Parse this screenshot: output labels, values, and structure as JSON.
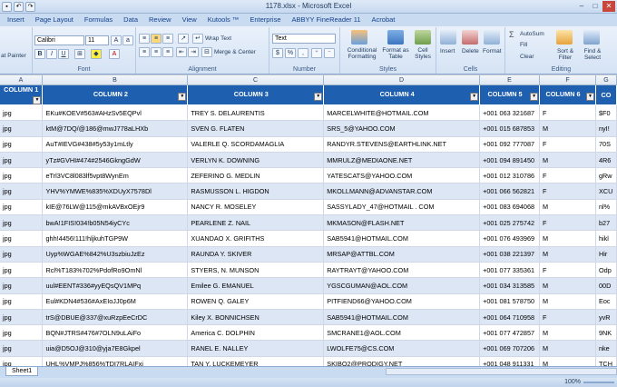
{
  "window": {
    "title": "1178.xlsx - Microsoft Excel"
  },
  "tabs": [
    "Insert",
    "Page Layout",
    "Formulas",
    "Data",
    "Review",
    "View",
    "Kutools ™",
    "Enterprise",
    "ABBYY FineReader 11",
    "Acrobat"
  ],
  "ribbon": {
    "clipboard": {
      "format_painter": "at Painter"
    },
    "font": {
      "name": "Calibri",
      "size": "11",
      "label": "Font"
    },
    "alignment": {
      "wrap_text": "Wrap Text",
      "merge_center": "Merge & Center",
      "label": "Alignment"
    },
    "number": {
      "format": "Text",
      "label": "Number"
    },
    "styles": {
      "conditional": "Conditional Formatting",
      "format_table": "Format as Table",
      "cell_styles": "Cell Styles",
      "label": "Styles"
    },
    "cells": {
      "insert": "Insert",
      "delete": "Delete",
      "format": "Format",
      "label": "Cells"
    },
    "editing": {
      "autosum": "AutoSum",
      "fill": "Fill",
      "clear": "Clear",
      "sort_filter": "Sort & Filter",
      "find_select": "Find & Select",
      "label": "Editing"
    }
  },
  "column_letters": [
    "A",
    "B",
    "C",
    "D",
    "E",
    "F",
    "G"
  ],
  "headers": [
    "COLUMN 1",
    "COLUMN 2",
    "COLUMN 3",
    "COLUMN 4",
    "COLUMN 5",
    "COLUMN 6",
    "CO"
  ],
  "rows": [
    [
      "jpg",
      "EKu#KOEV#563#AHzSv5EQPvl",
      "TREY S. DELAURENTIS",
      "MARCELWHITE@HOTMAIL.COM",
      "+001 063 321687",
      "F",
      "$F0"
    ],
    [
      "jpg",
      "ktM@7DQ/@186@mwJ778aLHXb",
      "SVEN G. FLATEN",
      "SRS_5@YAHOO.COM",
      "+001 015 687853",
      "M",
      "nyI!"
    ],
    [
      "jpg",
      "AuT#IEVG#438#5y53y1mLtly",
      "VALERLE Q. SCORDAMAGLIA",
      "RANDYR.STEVENS@EARTHLINK.NET",
      "+001 092 777087",
      "F",
      "70S"
    ],
    [
      "jpg",
      "yTz#GVHI#474#2546GkngGdW",
      "VERLYN K. DOWNING",
      "MMRULZ@MEDIAONE.NET",
      "+001 094 891450",
      "M",
      "4R6"
    ],
    [
      "jpg",
      "eTrl3VC8l083lf5vpt8WynEm",
      "ZEFERINO G. MEDLIN",
      "YATESCATS@YAHOO.COM",
      "+001 012 310786",
      "F",
      "gRw"
    ],
    [
      "jpg",
      "YHV%YMWE%835%XDUyX7578Dl",
      "RASMUSSON L. HIGDON",
      "MKOLLMANN@ADVANSTAR.COM",
      "+001 066 562821",
      "F",
      "XCU"
    ],
    [
      "jpg",
      "kIE@76LW@115@mkAVBxOEjr9",
      "NANCY R. MOSELEY",
      "SASSYLADY_47@HOTMAIL . COM",
      "+001 083 694068",
      "M",
      "nl%"
    ],
    [
      "jpg",
      "bwA!1FIS!034!b05N54iyCYc",
      "PEARLENE Z. NAIL",
      "MKMASON@FLASH.NET",
      "+001 025 275742",
      "F",
      "b27"
    ],
    [
      "jpg",
      "ghh!4456!111!hljkuhTGP9W",
      "XUANDAO X. GRIFITHS",
      "SAB5941@HOTMAIL.COM",
      "+001 076 493969",
      "M",
      "hikl"
    ],
    [
      "jpg",
      "Uyp%WGAE%842%U3szbiuJzEz",
      "RAUNDA Y. SKIVER",
      "MRSAP@ATTBL.COM",
      "+001 038 221397",
      "M",
      "Hir"
    ],
    [
      "jpg",
      "Rcl%T183%702%PdofRo9OmNl",
      "STYERS, N. MUNSON",
      "RAYTRAYT@YAHOO.COM",
      "+001 077 335361",
      "F",
      "Odp"
    ],
    [
      "jpg",
      "uul#EENT#336#yyEQsQV1MPq",
      "Emilee G. EMANUEL",
      "YGSCGUMAN@AOL.COM",
      "+001 034 313585",
      "M",
      "00D"
    ],
    [
      "jpg",
      "Eul#KDN4#536#AxEIoJJ0p6M",
      "ROWEN Q. GALEY",
      "PITFIEND66@YAHOO.COM",
      "+001 081 578750",
      "M",
      "Eoc"
    ],
    [
      "jpg",
      "trS@DBUE@337@xuRzpEeCrDC",
      "Kiley X. BONNICHSEN",
      "SAB5941@HOTMAIL.COM",
      "+001 064 710958",
      "F",
      "yvR"
    ],
    [
      "jpg",
      "BQN#JTRS#476#7OLN9uLAiFo",
      "America C. DOLPHIN",
      "SMCRANE1@AOL.COM",
      "+001 077 472857",
      "M",
      "9NK"
    ],
    [
      "jpg",
      "uia@D5OJ@310@yja7E8Gkpel",
      "RANEL E. NALLEY",
      "LWOLFE75@CS.COM",
      "+001 069 707206",
      "M",
      "nke"
    ],
    [
      "jpg",
      "UHL%VMPJ%856%TDI7RLAIFxi",
      "TAN Y. LUCKEMEYER",
      "SKIBO2@PRODIGY.NET",
      "+001 048 911331",
      "M",
      "TCH"
    ]
  ],
  "sheet_tab": "Sheet1",
  "zoom": "100%"
}
